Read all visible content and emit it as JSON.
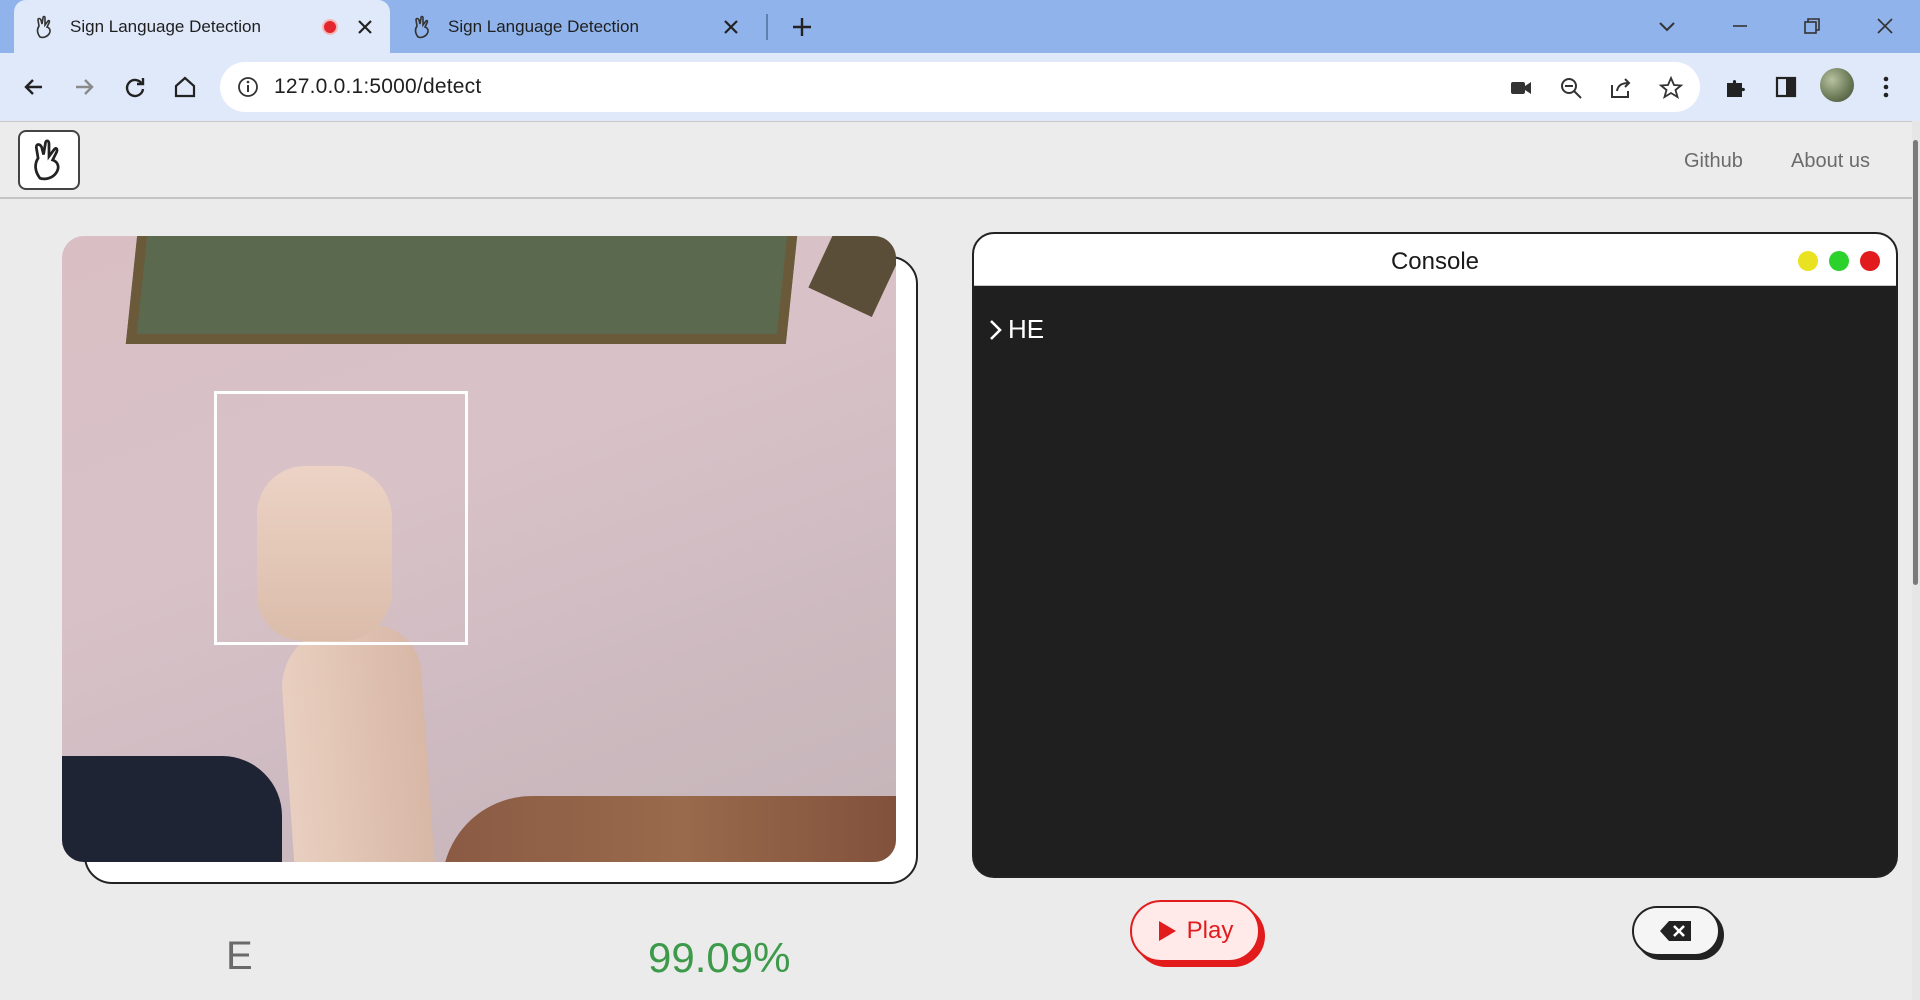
{
  "browser": {
    "tabs": [
      {
        "title": "Sign Language Detection",
        "active": true,
        "recording": true
      },
      {
        "title": "Sign Language Detection",
        "active": false
      }
    ],
    "url": "127.0.0.1:5000/detect"
  },
  "navbar": {
    "links": [
      "Github",
      "About us"
    ]
  },
  "camera": {
    "prediction_letter": "E",
    "confidence": "99.09%"
  },
  "console": {
    "title": "Console",
    "output": "HE",
    "dot_colors": [
      "#e9e220",
      "#2bd22b",
      "#e21c1c"
    ]
  },
  "controls": {
    "play_label": "Play"
  },
  "colors": {
    "accent_red": "#e21c1c",
    "confidence_green": "#3d9a4a",
    "tabstrip": "#8fb3ea"
  }
}
